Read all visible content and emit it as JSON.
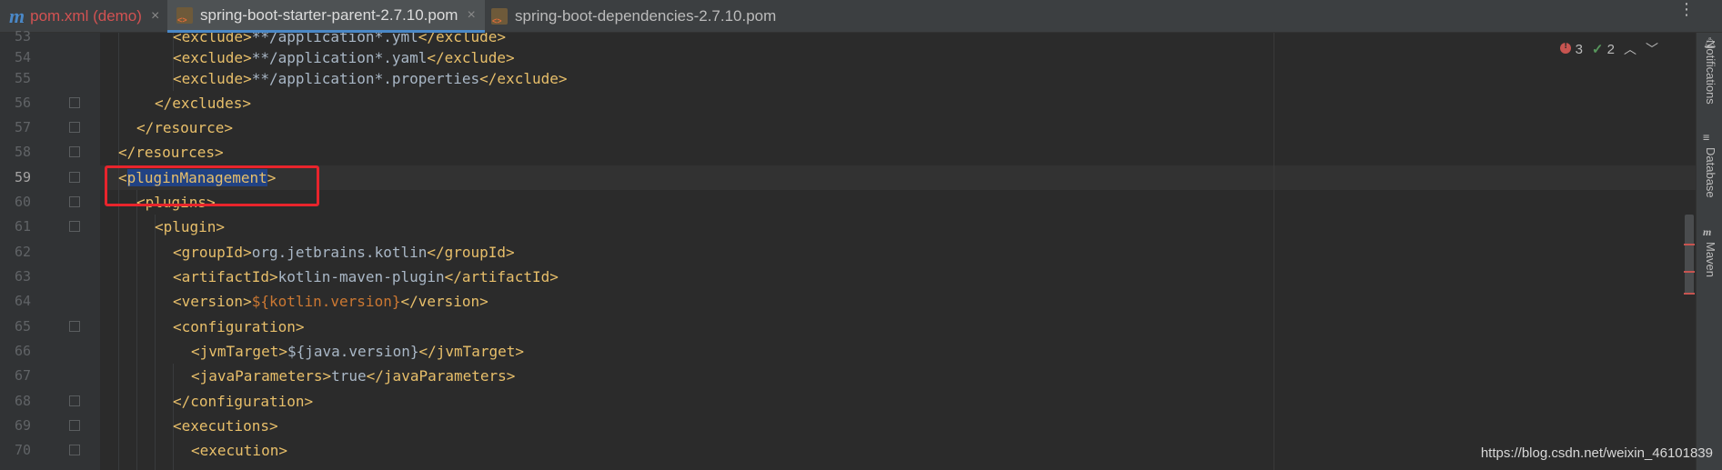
{
  "tabs": [
    {
      "label": "pom.xml (demo)",
      "icon": "maven-m-icon",
      "close": "×"
    },
    {
      "label": "spring-boot-starter-parent-2.7.10.pom",
      "icon": "xml-file-icon",
      "close": "×"
    },
    {
      "label": "spring-boot-dependencies-2.7.10.pom",
      "icon": "xml-file-icon",
      "close": ""
    }
  ],
  "tab_menu": "⋮",
  "inspections": {
    "errors": "3",
    "ok": "2"
  },
  "right_tools": {
    "notifications": "Notifications",
    "database": "Database",
    "maven": "Maven"
  },
  "line_numbers": [
    "53",
    "54",
    "55",
    "56",
    "57",
    "58",
    "59",
    "60",
    "61",
    "62",
    "63",
    "64",
    "65",
    "66",
    "67",
    "68",
    "69",
    "70"
  ],
  "code": {
    "l53_open": "<exclude>",
    "l53_text": "**/application*.yml",
    "l53_close": "</exclude>",
    "l54_open": "<exclude>",
    "l54_text": "**/application*.yaml",
    "l54_close": "</exclude>",
    "l55_open": "<exclude>",
    "l55_text": "**/application*.properties",
    "l55_close": "</exclude>",
    "l56": "</excludes>",
    "l57": "</resource>",
    "l58": "</resources>",
    "l59_lt": "<",
    "l59_name": "pluginManagement",
    "l59_gt": ">",
    "l60": "<plugins>",
    "l61": "<plugin>",
    "l62_open": "<groupId>",
    "l62_text": "org.jetbrains.kotlin",
    "l62_close": "</groupId>",
    "l63_open": "<artifactId>",
    "l63_text": "kotlin-maven-plugin",
    "l63_close": "</artifactId>",
    "l64_open": "<version>",
    "l64_var": "${kotlin.version}",
    "l64_close": "</version>",
    "l65": "<configuration>",
    "l66_open": "<jvmTarget>",
    "l66_text": "${java.version}",
    "l66_close": "</jvmTarget>",
    "l67_open": "<javaParameters>",
    "l67_text": "true",
    "l67_close": "</javaParameters>",
    "l68": "</configuration>",
    "l69": "<executions>",
    "l70": "<execution>"
  },
  "watermark": "https://blog.csdn.net/weixin_46101839",
  "colors": {
    "tag": "#e8bf6a",
    "text": "#a9b7c6",
    "variable": "#cc7832",
    "highlight_box": "#e8242c",
    "selection": "#214283"
  }
}
